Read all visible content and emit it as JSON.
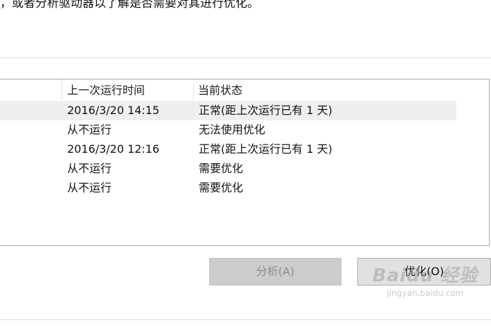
{
  "description_text": "，或者分析驱动器以了解是否需要对其进行优化。",
  "table": {
    "columns": [
      "上一次运行时间",
      "当前状态"
    ],
    "rows": [
      {
        "last_run": "2016/3/20 14:15",
        "status": "正常(距上次运行已有 1 天)",
        "selected": true
      },
      {
        "last_run": "从不运行",
        "status": "无法使用优化",
        "selected": false
      },
      {
        "last_run": "2016/3/20 12:16",
        "status": "正常(距上次运行已有 1 天)",
        "selected": false
      },
      {
        "last_run": "从不运行",
        "status": "需要优化",
        "selected": false
      },
      {
        "last_run": "从不运行",
        "status": "需要优化",
        "selected": false
      }
    ]
  },
  "buttons": {
    "analyze": {
      "label": "分析(A)",
      "enabled": false
    },
    "optimize": {
      "label": "优化(O)",
      "enabled": true
    }
  },
  "watermark": {
    "logo": "Baidu 经验",
    "url": "jingyan.baidu.com"
  }
}
